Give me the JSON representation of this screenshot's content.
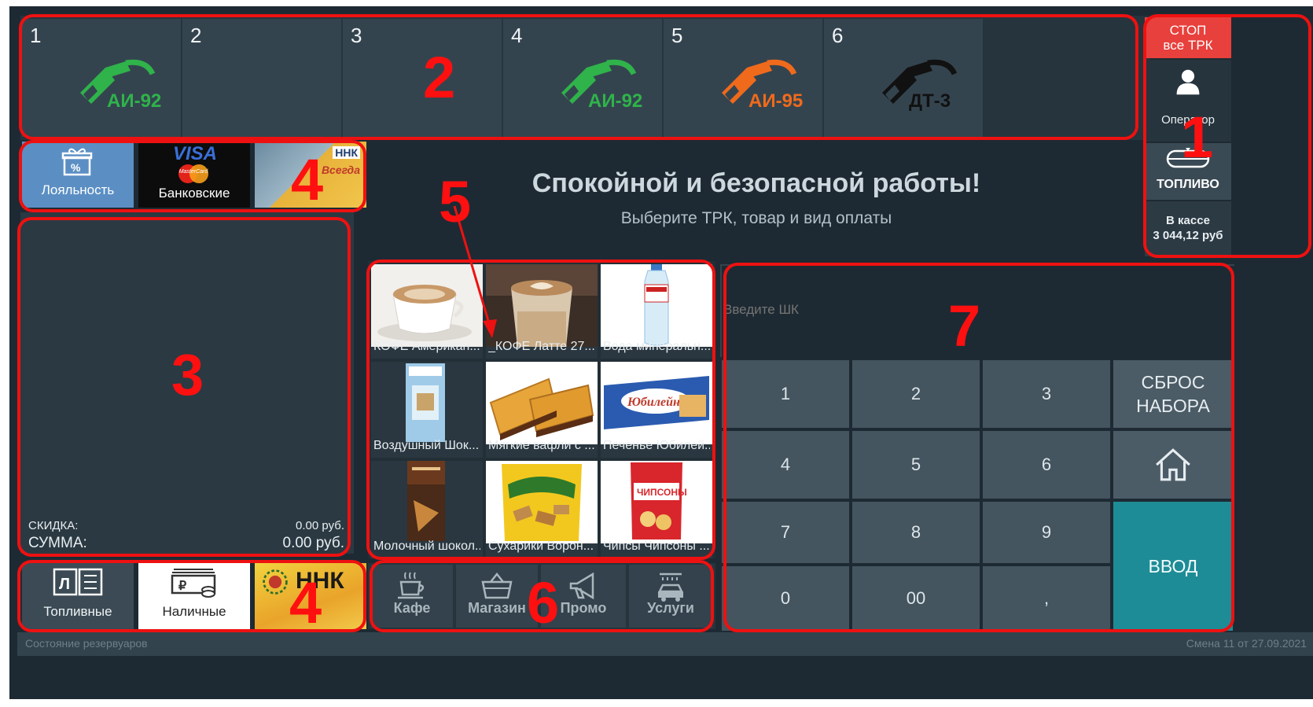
{
  "pumps": [
    {
      "number": "1",
      "fuel": "АИ-92",
      "color": "#2fb34a"
    },
    {
      "number": "2",
      "fuel": "",
      "color": ""
    },
    {
      "number": "3",
      "fuel": "",
      "color": ""
    },
    {
      "number": "4",
      "fuel": "АИ-92",
      "color": "#2fb34a"
    },
    {
      "number": "5",
      "fuel": "АИ-95",
      "color": "#f06a1c"
    },
    {
      "number": "6",
      "fuel": "ДТ-3",
      "color": "#111111"
    }
  ],
  "side": {
    "stop_label_1": "СТОП",
    "stop_label_2": "все ТРК",
    "operator_label": "Оператор",
    "fuel_label": "ТОПЛИВО",
    "cash_label": "В кассе",
    "cash_value": "3 044,12 руб"
  },
  "payments_top": {
    "loyalty_label": "Лояльность",
    "bank_label": "Банковские",
    "visa_text": "VISA",
    "mastercard_text": "MasterCard",
    "nnk_text": "ННК",
    "nnk_slogan": "Всегда"
  },
  "payments_bottom": {
    "fuel_cards_label": "Топливные",
    "cash_label": "Наличные",
    "nnk_text": "ННК"
  },
  "greeting": {
    "title": "Спокойной и безопасной работы!",
    "subtitle": "Выберите ТРК, товар и вид оплаты"
  },
  "check": {
    "discount_label": "СКИДКА:",
    "discount_value": "0.00 руб.",
    "sum_label": "СУММА:",
    "sum_value": "0.00 руб."
  },
  "products": [
    {
      "name": "КОФЕ Американ..."
    },
    {
      "name": "_КОФЕ Латте 27..."
    },
    {
      "name": "Вода минеральн..."
    },
    {
      "name": "Воздушный Шок..."
    },
    {
      "name": "Мягкие вафли с ..."
    },
    {
      "name": "Печенье Юбилей..."
    },
    {
      "name": "Молочный шокол..."
    },
    {
      "name": "Сухарики Ворон..."
    },
    {
      "name": "Чипсы Чипсоны ..."
    }
  ],
  "categories": [
    {
      "label": "Кафе",
      "icon": "cup-icon"
    },
    {
      "label": "Магазин",
      "icon": "basket-icon"
    },
    {
      "label": "Промо",
      "icon": "megaphone-icon"
    },
    {
      "label": "Услуги",
      "icon": "car-wash-icon"
    }
  ],
  "barcode": {
    "placeholder": "Введите ШК"
  },
  "keypad": {
    "keys": [
      "1",
      "2",
      "3",
      "4",
      "5",
      "6",
      "7",
      "8",
      "9",
      "0",
      "00",
      ","
    ],
    "reset_label_1": "СБРОС",
    "reset_label_2": "НАБОРА",
    "enter_label": "ВВОД"
  },
  "status": {
    "left": "Состояние резервуаров",
    "right": "Смена 11 от 27.09.2021"
  },
  "annotations": [
    "1",
    "2",
    "3",
    "4",
    "4",
    "5",
    "6",
    "7"
  ],
  "colors": {
    "annotation": "#ee1111",
    "enter": "#1e8c96",
    "stop": "#e8403c",
    "background": "#1e2a33"
  }
}
